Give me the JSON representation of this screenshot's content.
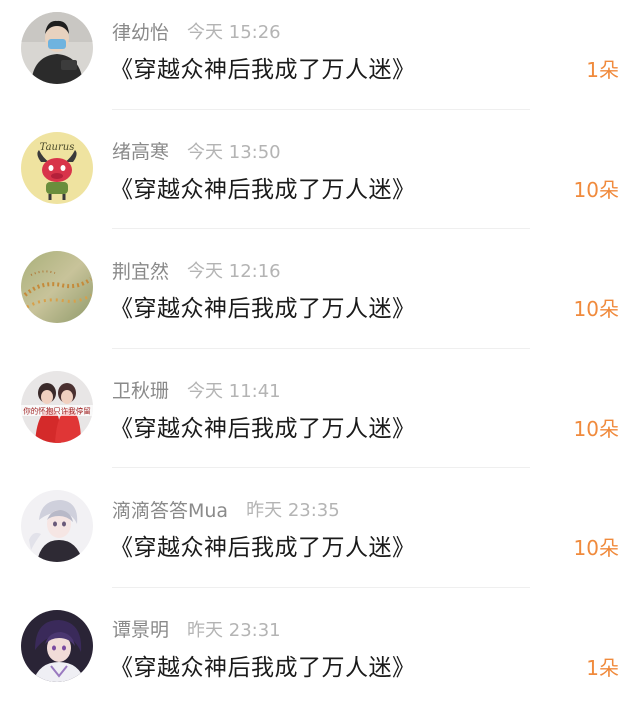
{
  "comments": [
    {
      "username": "律幼怡",
      "time": "今天 15:26",
      "message": "《穿越众神后我成了万人迷》",
      "gift": "1朵",
      "avatar": "avatar-person-mask"
    },
    {
      "username": "绪高寒",
      "time": "今天 13:50",
      "message": "《穿越众神后我成了万人迷》",
      "gift": "10朵",
      "avatar": "avatar-taurus",
      "avatar_text": "Taurus"
    },
    {
      "username": "荆宜然",
      "time": "今天 12:16",
      "message": "《穿越众神后我成了万人迷》",
      "gift": "10朵",
      "avatar": "avatar-flowers"
    },
    {
      "username": "卫秋珊",
      "time": "今天 11:41",
      "message": "《穿越众神后我成了万人迷》",
      "gift": "10朵",
      "avatar": "avatar-couple",
      "avatar_text": "你的怀抱只许我停留"
    },
    {
      "username": "滴滴答答Mua",
      "time": "昨天 23:35",
      "message": "《穿越众神后我成了万人迷》",
      "gift": "10朵",
      "avatar": "avatar-anime-boy"
    },
    {
      "username": "谭景明",
      "time": "昨天 23:31",
      "message": "《穿越众神后我成了万人迷》",
      "gift": "1朵",
      "avatar": "avatar-anime-purple"
    }
  ],
  "colors": {
    "username": "#8a8a8a",
    "time": "#b4b4b4",
    "message": "#1b1b1b",
    "gift": "#f08a3c",
    "divider": "#efefef"
  }
}
